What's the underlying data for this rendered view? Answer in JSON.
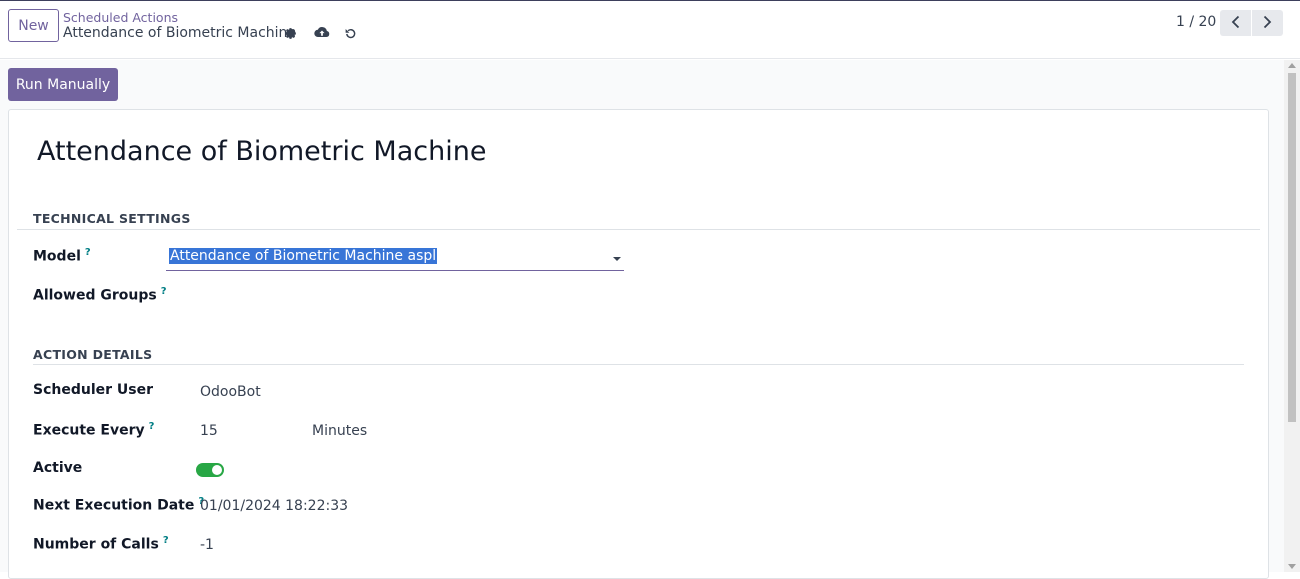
{
  "header": {
    "new_label": "New",
    "breadcrumb_parent": "Scheduled Actions",
    "breadcrumb_current": "Attendance of Biometric Machine",
    "icons": [
      "gear-icon",
      "cloud-upload-icon",
      "undo-icon"
    ]
  },
  "pager": {
    "value": "1 / 20",
    "prev_icon": "chevron-left-icon",
    "next_icon": "chevron-right-icon"
  },
  "actions": {
    "run_manually_label": "Run Manually"
  },
  "form": {
    "title": "Attendance of Biometric Machine",
    "technical_settings": {
      "heading": "TECHNICAL SETTINGS",
      "model_label": "Model",
      "model_help": "?",
      "model_value": "Attendance of Biometric Machine aspl",
      "allowed_groups_label": "Allowed Groups",
      "allowed_groups_help": "?"
    },
    "action_details": {
      "heading": "ACTION DETAILS",
      "scheduler_user_label": "Scheduler User",
      "scheduler_user_value": "OdooBot",
      "execute_every_label": "Execute Every",
      "execute_every_help": "?",
      "execute_every_value": "15",
      "execute_every_unit": "Minutes",
      "active_label": "Active",
      "active_value": true,
      "next_execution_label": "Next Execution Date",
      "next_execution_help": "?",
      "next_execution_value": "01/01/2024 18:22:33",
      "number_of_calls_label": "Number of Calls",
      "number_of_calls_help": "?",
      "number_of_calls_value": "-1"
    }
  },
  "colors": {
    "primary": "#71639e",
    "toggle_on": "#28a745",
    "help": "#017e84",
    "selection": "#3875d7"
  }
}
